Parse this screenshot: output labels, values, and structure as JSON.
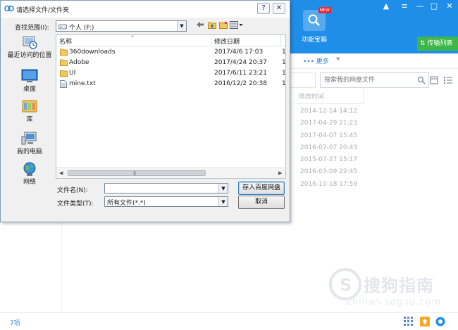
{
  "dialog": {
    "title": "请选择文件/文件夹",
    "look_in_label": "查找范围(I):",
    "look_in_value": "个人 (F:)",
    "places": [
      {
        "label": "最近访问的位置"
      },
      {
        "label": "桌面"
      },
      {
        "label": "库"
      },
      {
        "label": "我的电脑"
      },
      {
        "label": "网络"
      }
    ],
    "columns": {
      "name": "名称",
      "modified": "修改日期"
    },
    "files": [
      {
        "name": "360downloads",
        "date": "2017/4/6 17:03",
        "extra": "1",
        "type": "folder"
      },
      {
        "name": "Adobe",
        "date": "2017/4/24 20:37",
        "extra": "1",
        "type": "folder"
      },
      {
        "name": "UI",
        "date": "2017/6/11 23:21",
        "extra": "1",
        "type": "folder"
      },
      {
        "name": "mine.txt",
        "date": "2016/12/2 20:38",
        "extra": "1",
        "type": "file"
      }
    ],
    "file_name_label": "文件名(N):",
    "file_name_value": "",
    "file_type_label": "文件类型(T):",
    "file_type_value": "所有文件(*.*)",
    "save_button": "存入百度网盘",
    "cancel_button": "取消"
  },
  "app": {
    "feature_label": "功能宝箱",
    "new_badge": "NEW",
    "transfer_tab": "传输列表",
    "more_label": "••• 更多",
    "search_placeholder": "搜索我的网盘文件",
    "column_modified": "修改时间",
    "dates": [
      "2014-12-14 14:12",
      "2017-04-29 21:23",
      "2017-04-07 15:45",
      "2016-07-07 20:43",
      "2015-07-27 15:17",
      "2016-03-09 22:45",
      "2016-10-18 17:59"
    ],
    "item_count": "7项",
    "watermark": "搜狗指南",
    "watermark_sub": "zhinan.sogou.com"
  },
  "colors": {
    "brand_blue": "#1f8ee8",
    "transfer_green": "#3fb64a"
  }
}
